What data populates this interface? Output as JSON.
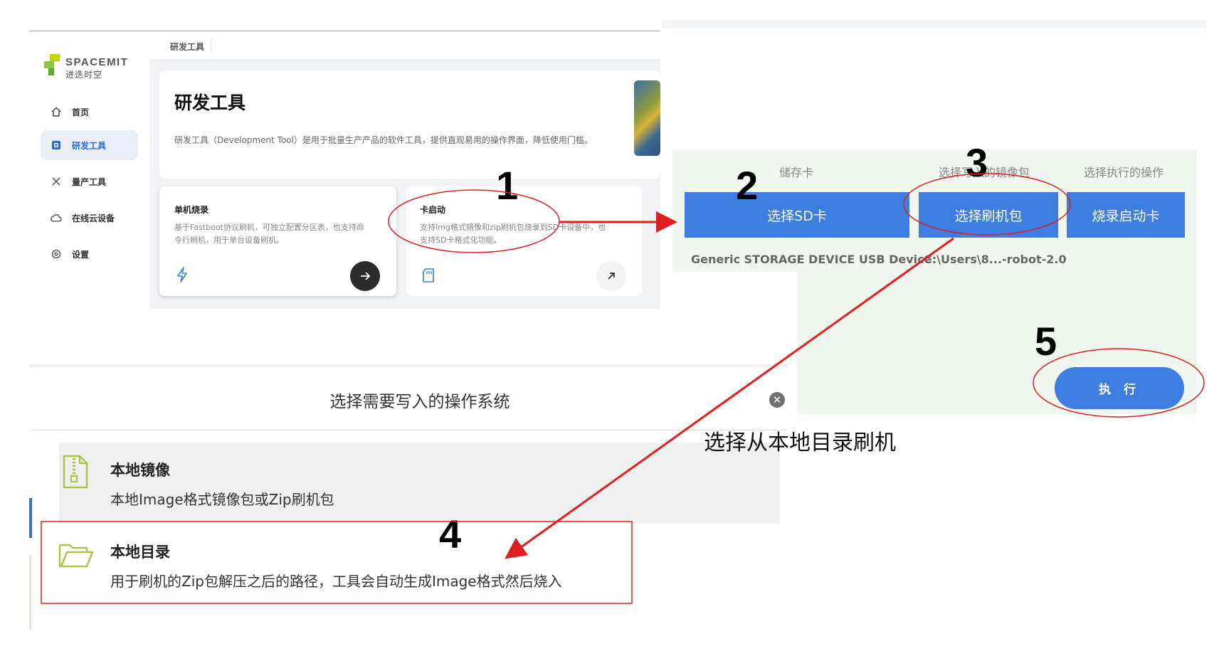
{
  "app": {
    "brand": "SPACEMIT",
    "brand_sub": "进迭时空",
    "nav": [
      {
        "label": "首页",
        "icon": "home-icon",
        "active": false
      },
      {
        "label": "研发工具",
        "icon": "tool-box-icon",
        "active": true
      },
      {
        "label": "量产工具",
        "icon": "wrench-cross-icon",
        "active": false
      },
      {
        "label": "在线云设备",
        "icon": "cloud-icon",
        "active": false
      },
      {
        "label": "设置",
        "icon": "settings-icon",
        "active": false
      }
    ],
    "breadcrumb": "研发工具",
    "hero": {
      "title": "研发工具",
      "description": "研发工具（Development Tool）是用于批量生产产品的软件工具，提供直观易用的操作界面，降低使用门槛。"
    },
    "cards": [
      {
        "title": "单机烧录",
        "desc_line1": "基于Fastboot协议刷机，可独立配置分区表，也支持命",
        "desc_line2": "令行刷机，用于单台设备刷机。",
        "icon": "lightning-icon",
        "action_icon": "arrow-right-icon"
      },
      {
        "title": "卡启动",
        "desc_line1": "支持Img格式镜像和zip刷机包烧录到SD卡设备中，也",
        "desc_line2": "支持SD卡格式化功能。",
        "icon": "sd-card-icon",
        "action_icon": "arrow-up-right-icon"
      }
    ]
  },
  "sd_panel": {
    "columns": [
      {
        "header": "储存卡",
        "button": "选择SD卡",
        "info": "Generic STORAGE DEVICE USB Device"
      },
      {
        "header": "选择写入的镜像包",
        "button": "选择刷机包",
        "info": "C:\\Users\\8...-robot-2.0"
      },
      {
        "header": "选择执行的操作",
        "button": "烧录启动卡",
        "info": ""
      }
    ],
    "execute_button": "执 行"
  },
  "dialog": {
    "title": "选择需要写入的操作系统",
    "close_icon": "close-icon",
    "options": [
      {
        "title": "本地镜像",
        "desc": "本地Image格式镜像包或Zip刷机包",
        "icon": "zip-file-icon"
      },
      {
        "title": "本地目录",
        "desc": "用于刷机的Zip包解压之后的路径，工具会自动生成Image格式然后烧入",
        "icon": "folder-open-icon"
      }
    ]
  },
  "annotations": {
    "steps": [
      "1",
      "2",
      "3",
      "4",
      "5"
    ],
    "caption": "选择从本地目录刷机",
    "color": "#e02020"
  }
}
